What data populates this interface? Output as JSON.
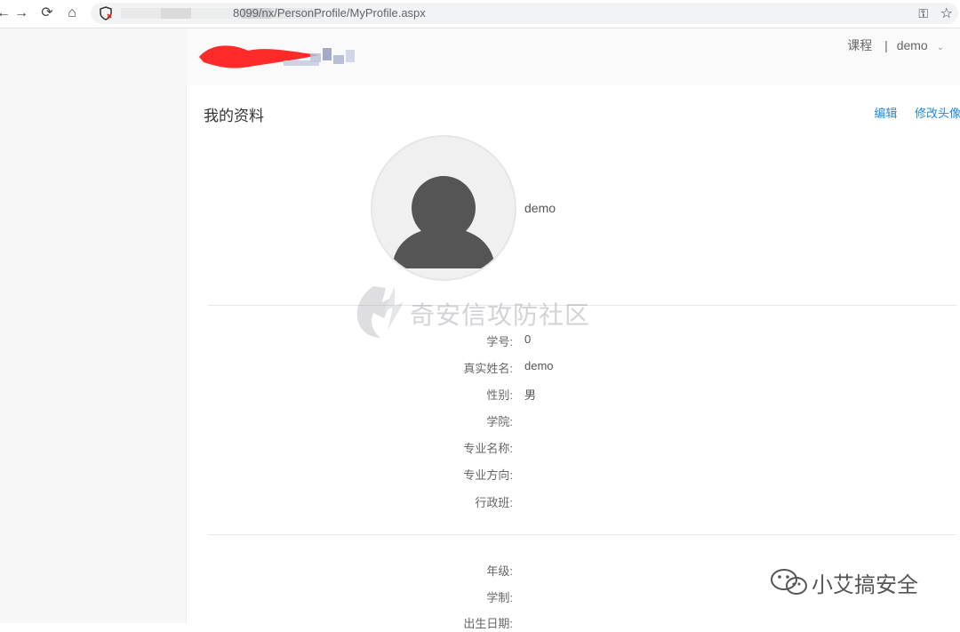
{
  "browser": {
    "url_visible": "8099/nx/PersonProfile/MyProfile.aspx"
  },
  "header": {
    "links": [
      {
        "label": "课程"
      },
      {
        "label": "|"
      },
      {
        "label": "demo"
      }
    ]
  },
  "page": {
    "title": "我的资料",
    "actions": [
      {
        "label": "编辑"
      },
      {
        "label": "修改头像"
      }
    ],
    "user_name": "demo"
  },
  "profile_fields": [
    {
      "label": "学号:",
      "value": "0"
    },
    {
      "label": "真实姓名:",
      "value": "demo"
    },
    {
      "label": "性别:",
      "value": "男"
    },
    {
      "label": "学院:",
      "value": ""
    },
    {
      "label": "专业名称:",
      "value": ""
    },
    {
      "label": "专业方向:",
      "value": ""
    },
    {
      "label": "行政班:",
      "value": ""
    }
  ],
  "extra_fields": [
    {
      "label": "年级:",
      "value": ""
    },
    {
      "label": "学制:",
      "value": ""
    },
    {
      "label": "出生日期:",
      "value": ""
    }
  ],
  "overlays": {
    "watermark_text": "奇安信攻防社区",
    "wechat_text": "小艾搞安全"
  }
}
